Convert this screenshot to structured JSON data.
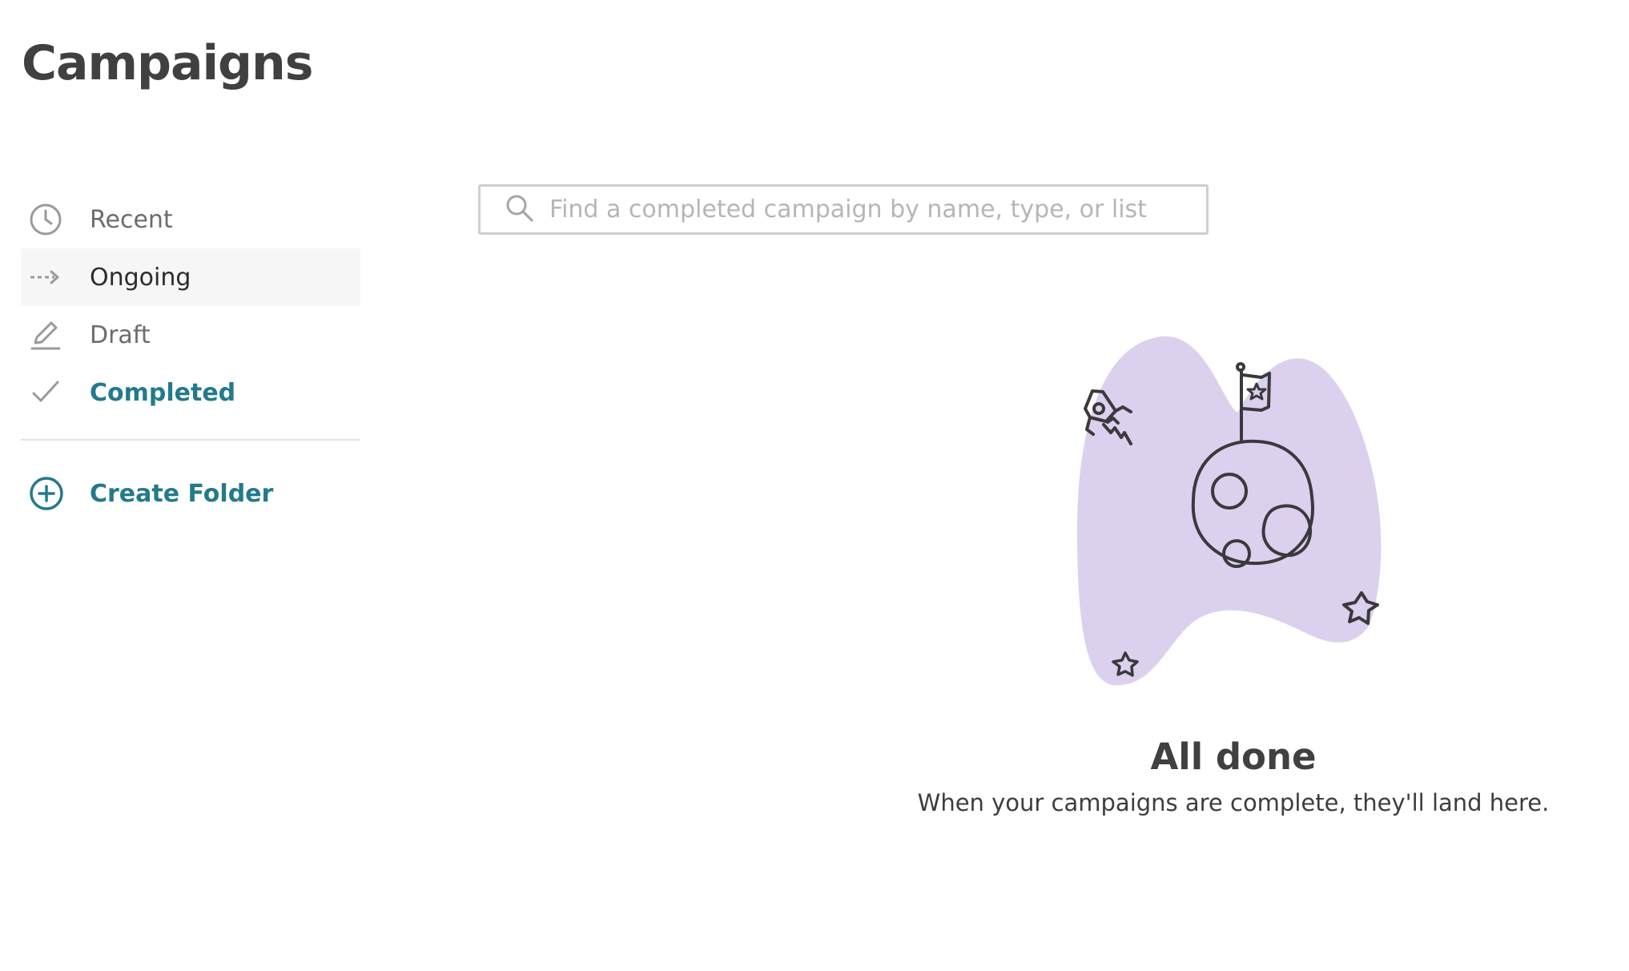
{
  "page": {
    "title": "Campaigns"
  },
  "sidebar": {
    "items": [
      {
        "label": "Recent",
        "icon": "clock-icon"
      },
      {
        "label": "Ongoing",
        "icon": "dashed-arrow-icon",
        "state": "hover"
      },
      {
        "label": "Draft",
        "icon": "pencil-icon"
      },
      {
        "label": "Completed",
        "icon": "checkmark-icon",
        "state": "active"
      }
    ],
    "create_folder": {
      "label": "Create Folder",
      "icon": "plus-circle-icon"
    }
  },
  "search": {
    "placeholder": "Find a completed campaign by name, type, or list",
    "value": "",
    "icon": "search-icon"
  },
  "empty_state": {
    "illustration": "moon-with-flag-rocket-stars",
    "title": "All done",
    "subtitle": "When your campaigns are complete, they'll land here."
  },
  "colors": {
    "accent": "#237a8b",
    "blob": "#dcd0ef",
    "text": "#404040",
    "muted": "#6c6c6c"
  }
}
